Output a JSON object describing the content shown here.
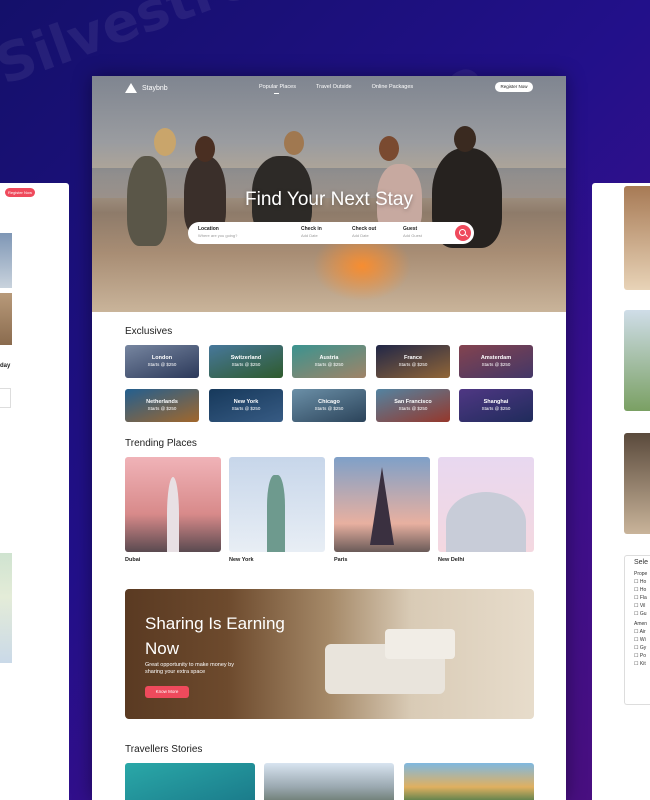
{
  "brand": {
    "name": "Staybnb"
  },
  "nav": {
    "links": [
      "Popular Places",
      "Travel Outside",
      "Online Packages"
    ],
    "register": "Register Now"
  },
  "hero": {
    "title": "Find Your Next Stay"
  },
  "search": {
    "fields": [
      {
        "label": "Location",
        "placeholder": "Where are you going?"
      },
      {
        "label": "Check in",
        "placeholder": "Add Date"
      },
      {
        "label": "Check out",
        "placeholder": "Add Date"
      },
      {
        "label": "Guest",
        "placeholder": "Add Guest"
      }
    ],
    "icon": "search-icon"
  },
  "exclusives": {
    "title": "Exclusives",
    "items": [
      {
        "city": "London",
        "price": "Starts @ $250"
      },
      {
        "city": "Switzerland",
        "price": "Starts @ $250"
      },
      {
        "city": "Austria",
        "price": "Starts @ $250"
      },
      {
        "city": "France",
        "price": "Starts @ $250"
      },
      {
        "city": "Amsterdam",
        "price": "Starts @ $250"
      },
      {
        "city": "Netherlands",
        "price": "Starts @ $250"
      },
      {
        "city": "New York",
        "price": "Starts @ $250"
      },
      {
        "city": "Chicago",
        "price": "Starts @ $250"
      },
      {
        "city": "San Francisco",
        "price": "Starts @ $250"
      },
      {
        "city": "Shanghai",
        "price": "Starts @ $250"
      }
    ]
  },
  "trending": {
    "title": "Trending Places",
    "items": [
      "Dubai",
      "New York",
      "Paris",
      "New Delhi"
    ]
  },
  "banner": {
    "title": "Sharing Is Earning Now",
    "subtitle": "Great opportunity to make money by sharing your extra space",
    "button": "Know More"
  },
  "stories": {
    "title": "Travellers Stories"
  },
  "side_left": {
    "button": "Register Now",
    "label": "day"
  },
  "side_right": {
    "filter_title": "Sele",
    "groups": [
      "Prope",
      "Amen"
    ],
    "options": [
      "Ho",
      "Ho",
      "Fla",
      "Vil",
      "Gu",
      "Air",
      "Wi",
      "Gy",
      "Po",
      "Kit"
    ]
  },
  "watermark": "Silvestre",
  "colors": {
    "accent": "#ef4a5c",
    "background": "#22108a"
  }
}
